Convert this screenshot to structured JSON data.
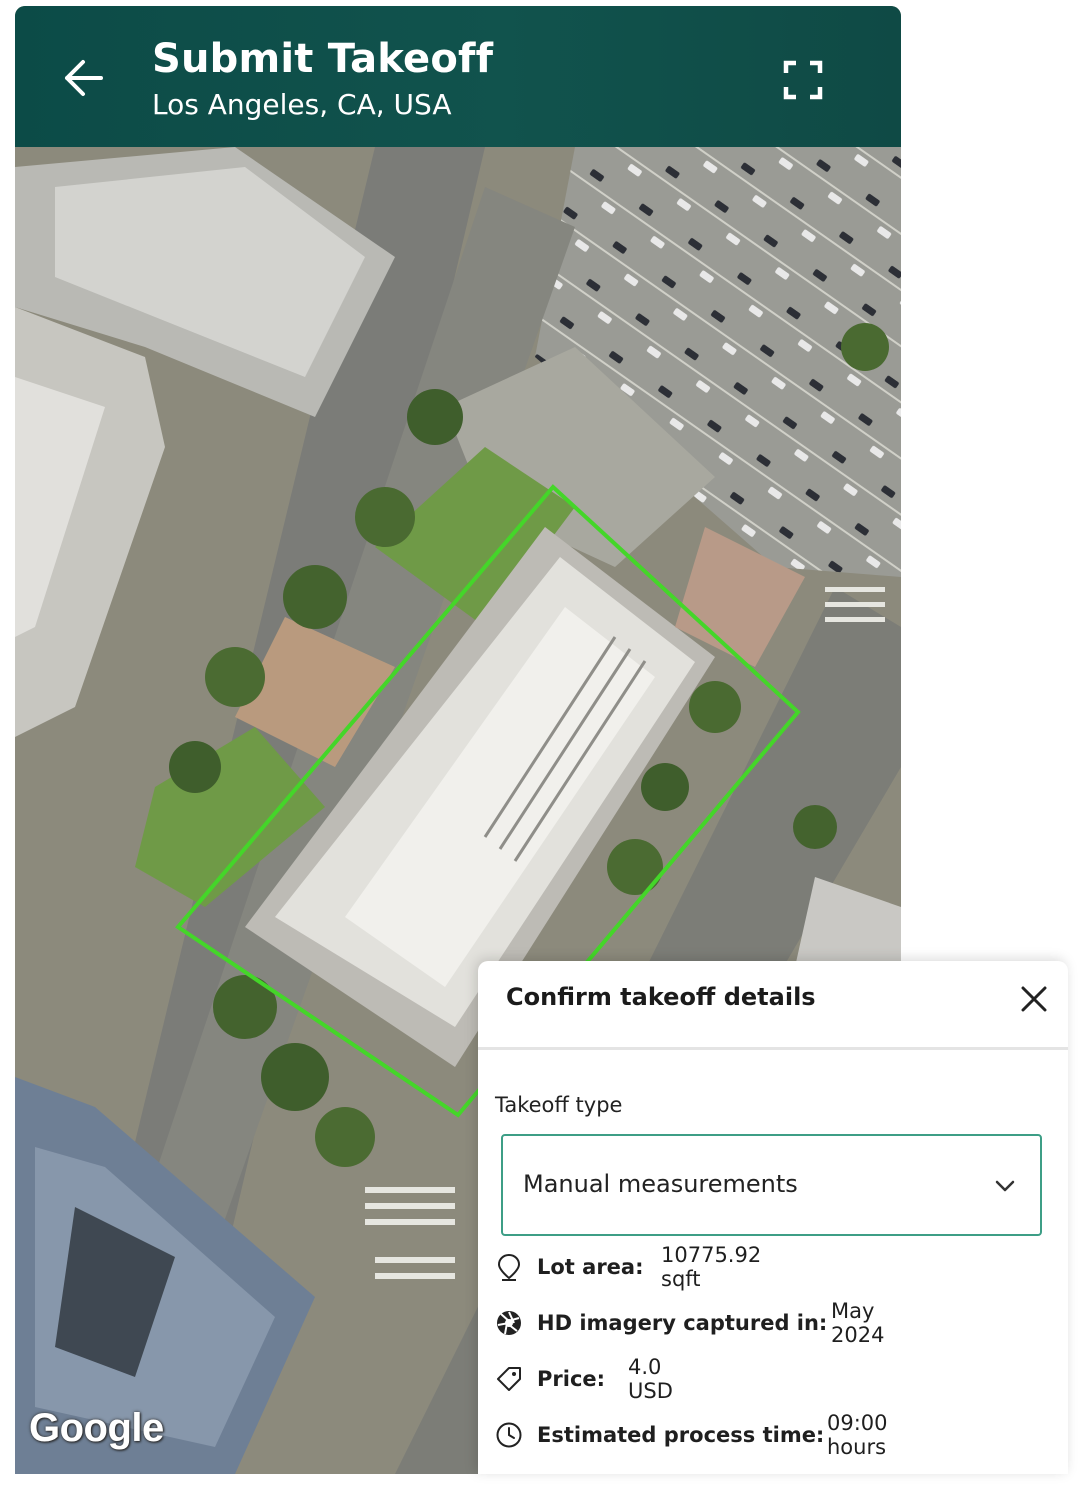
{
  "header": {
    "title": "Submit Takeoff",
    "subtitle": "Los Angeles, CA, USA",
    "back_icon": "arrow-left-icon",
    "fullscreen_icon": "fullscreen-icon",
    "background": "#0e4e49"
  },
  "map": {
    "attribution": "Google",
    "outline_color": "#44d629"
  },
  "sheet": {
    "title": "Confirm takeoff details",
    "close_icon": "close-icon",
    "takeoff_type_label": "Takeoff type",
    "takeoff_type_value": "Manual measurements",
    "accent": "#3d9e86",
    "details": [
      {
        "icon": "map-pin-icon",
        "label": "Lot area:",
        "value": "10775.92 sqft"
      },
      {
        "icon": "aperture-icon",
        "label": "HD imagery captured in:",
        "value": "May 2024"
      },
      {
        "icon": "price-tag-icon",
        "label": "Price:",
        "value": "4.0 USD"
      },
      {
        "icon": "clock-icon",
        "label": "Estimated process time:",
        "value": "09:00 hours"
      }
    ]
  }
}
